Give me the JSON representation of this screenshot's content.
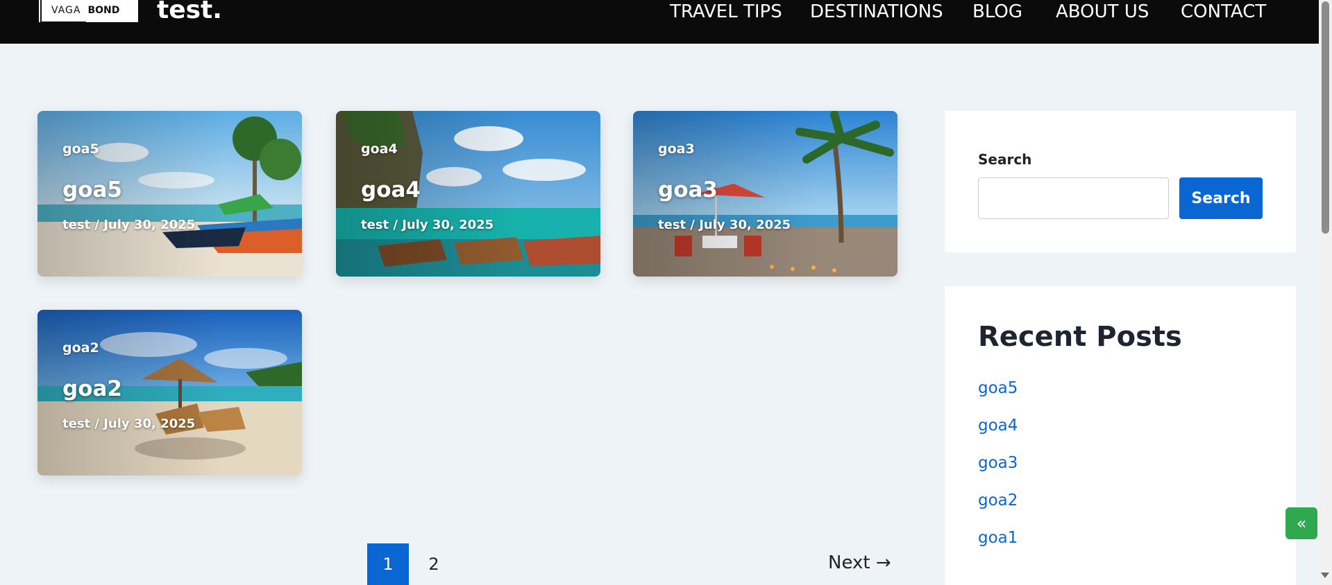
{
  "header": {
    "logo_left": "VAGA",
    "logo_right": "BOND",
    "site_title": "test.",
    "nav": [
      "TRAVEL TIPS",
      "DESTINATIONS",
      "BLOG",
      "ABOUT US",
      "CONTACT"
    ]
  },
  "posts": [
    {
      "category": "goa5",
      "title": "goa5",
      "meta": "test / July 30, 2025",
      "image": "beach-colorful-boats-palms"
    },
    {
      "category": "goa4",
      "title": "goa4",
      "meta": "test / July 30, 2025",
      "image": "limestone-cliff-longtail-boats"
    },
    {
      "category": "goa3",
      "title": "goa3",
      "meta": "test / July 30, 2025",
      "image": "beach-dinner-table-palm"
    },
    {
      "category": "goa2",
      "title": "goa2",
      "meta": "test / July 30, 2025",
      "image": "beach-umbrella-loungers"
    }
  ],
  "pagination": {
    "pages": [
      "1",
      "2"
    ],
    "current": "1",
    "next_label": "Next →"
  },
  "sidebar": {
    "search_label": "Search",
    "search_placeholder": "",
    "search_button": "Search",
    "recent_title": "Recent Posts",
    "recent_posts": [
      "goa5",
      "goa4",
      "goa3",
      "goa2",
      "goa1"
    ]
  },
  "floating_toggle": "«",
  "colors": {
    "accent": "#0a66d0",
    "header_bg": "#0b0b0b",
    "page_bg": "#eef3f8",
    "toggle_bg": "#2fa84f"
  }
}
